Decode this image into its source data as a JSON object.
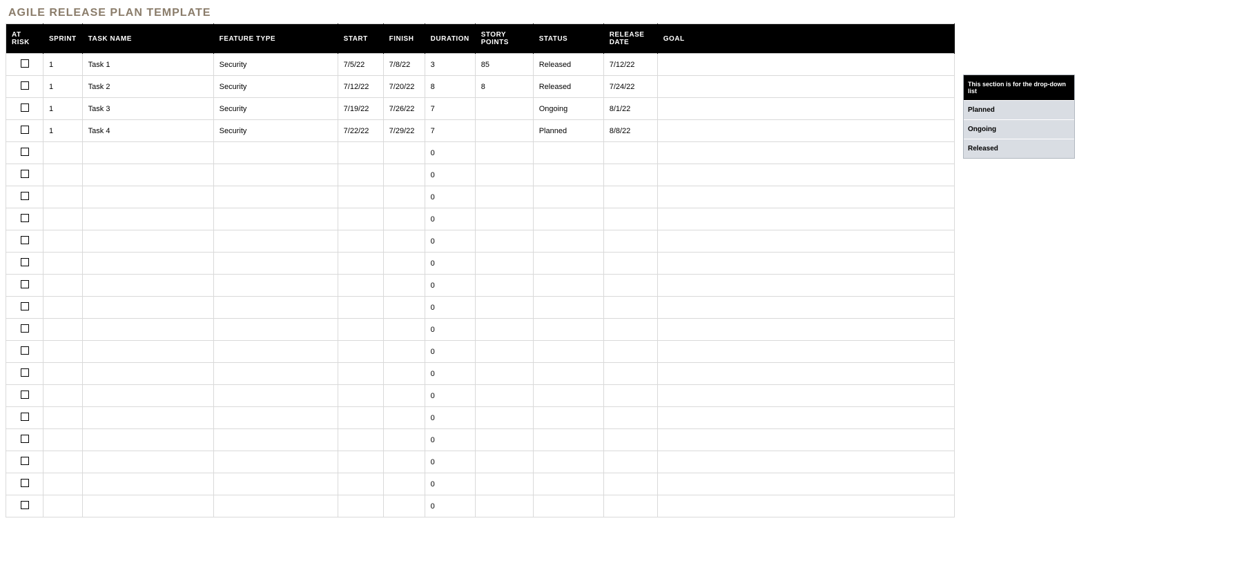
{
  "title": "AGILE RELEASE PLAN TEMPLATE",
  "columns": {
    "atRisk": "AT RISK",
    "sprint": "SPRINT",
    "taskName": "TASK NAME",
    "featureType": "FEATURE TYPE",
    "start": "START",
    "finish": "FINISH",
    "duration": "DURATION",
    "storyPoints": "STORY POINTS",
    "status": "STATUS",
    "releaseDate": "RELEASE DATE",
    "goal": "GOAL"
  },
  "rows": [
    {
      "sprint": "1",
      "taskName": "Task 1",
      "featureType": "Security",
      "start": "7/5/22",
      "finish": "7/8/22",
      "duration": "3",
      "storyPoints": "85",
      "status": "Released",
      "releaseDate": "7/12/22",
      "goal": ""
    },
    {
      "sprint": "1",
      "taskName": "Task 2",
      "featureType": "Security",
      "start": "7/12/22",
      "finish": "7/20/22",
      "duration": "8",
      "storyPoints": "8",
      "status": "Released",
      "releaseDate": "7/24/22",
      "goal": ""
    },
    {
      "sprint": "1",
      "taskName": "Task 3",
      "featureType": "Security",
      "start": "7/19/22",
      "finish": "7/26/22",
      "duration": "7",
      "storyPoints": "",
      "status": "Ongoing",
      "releaseDate": "8/1/22",
      "goal": ""
    },
    {
      "sprint": "1",
      "taskName": "Task 4",
      "featureType": "Security",
      "start": "7/22/22",
      "finish": "7/29/22",
      "duration": "7",
      "storyPoints": "",
      "status": "Planned",
      "releaseDate": "8/8/22",
      "goal": ""
    },
    {
      "sprint": "",
      "taskName": "",
      "featureType": "",
      "start": "",
      "finish": "",
      "duration": "0",
      "storyPoints": "",
      "status": "",
      "releaseDate": "",
      "goal": ""
    },
    {
      "sprint": "",
      "taskName": "",
      "featureType": "",
      "start": "",
      "finish": "",
      "duration": "0",
      "storyPoints": "",
      "status": "",
      "releaseDate": "",
      "goal": ""
    },
    {
      "sprint": "",
      "taskName": "",
      "featureType": "",
      "start": "",
      "finish": "",
      "duration": "0",
      "storyPoints": "",
      "status": "",
      "releaseDate": "",
      "goal": ""
    },
    {
      "sprint": "",
      "taskName": "",
      "featureType": "",
      "start": "",
      "finish": "",
      "duration": "0",
      "storyPoints": "",
      "status": "",
      "releaseDate": "",
      "goal": ""
    },
    {
      "sprint": "",
      "taskName": "",
      "featureType": "",
      "start": "",
      "finish": "",
      "duration": "0",
      "storyPoints": "",
      "status": "",
      "releaseDate": "",
      "goal": ""
    },
    {
      "sprint": "",
      "taskName": "",
      "featureType": "",
      "start": "",
      "finish": "",
      "duration": "0",
      "storyPoints": "",
      "status": "",
      "releaseDate": "",
      "goal": ""
    },
    {
      "sprint": "",
      "taskName": "",
      "featureType": "",
      "start": "",
      "finish": "",
      "duration": "0",
      "storyPoints": "",
      "status": "",
      "releaseDate": "",
      "goal": ""
    },
    {
      "sprint": "",
      "taskName": "",
      "featureType": "",
      "start": "",
      "finish": "",
      "duration": "0",
      "storyPoints": "",
      "status": "",
      "releaseDate": "",
      "goal": ""
    },
    {
      "sprint": "",
      "taskName": "",
      "featureType": "",
      "start": "",
      "finish": "",
      "duration": "0",
      "storyPoints": "",
      "status": "",
      "releaseDate": "",
      "goal": ""
    },
    {
      "sprint": "",
      "taskName": "",
      "featureType": "",
      "start": "",
      "finish": "",
      "duration": "0",
      "storyPoints": "",
      "status": "",
      "releaseDate": "",
      "goal": ""
    },
    {
      "sprint": "",
      "taskName": "",
      "featureType": "",
      "start": "",
      "finish": "",
      "duration": "0",
      "storyPoints": "",
      "status": "",
      "releaseDate": "",
      "goal": ""
    },
    {
      "sprint": "",
      "taskName": "",
      "featureType": "",
      "start": "",
      "finish": "",
      "duration": "0",
      "storyPoints": "",
      "status": "",
      "releaseDate": "",
      "goal": ""
    },
    {
      "sprint": "",
      "taskName": "",
      "featureType": "",
      "start": "",
      "finish": "",
      "duration": "0",
      "storyPoints": "",
      "status": "",
      "releaseDate": "",
      "goal": ""
    },
    {
      "sprint": "",
      "taskName": "",
      "featureType": "",
      "start": "",
      "finish": "",
      "duration": "0",
      "storyPoints": "",
      "status": "",
      "releaseDate": "",
      "goal": ""
    },
    {
      "sprint": "",
      "taskName": "",
      "featureType": "",
      "start": "",
      "finish": "",
      "duration": "0",
      "storyPoints": "",
      "status": "",
      "releaseDate": "",
      "goal": ""
    },
    {
      "sprint": "",
      "taskName": "",
      "featureType": "",
      "start": "",
      "finish": "",
      "duration": "0",
      "storyPoints": "",
      "status": "",
      "releaseDate": "",
      "goal": ""
    },
    {
      "sprint": "",
      "taskName": "",
      "featureType": "",
      "start": "",
      "finish": "",
      "duration": "0",
      "storyPoints": "",
      "status": "",
      "releaseDate": "",
      "goal": ""
    }
  ],
  "dropdown": {
    "header": "This section is for the drop-down list",
    "options": [
      "Planned",
      "Ongoing",
      "Released"
    ]
  }
}
